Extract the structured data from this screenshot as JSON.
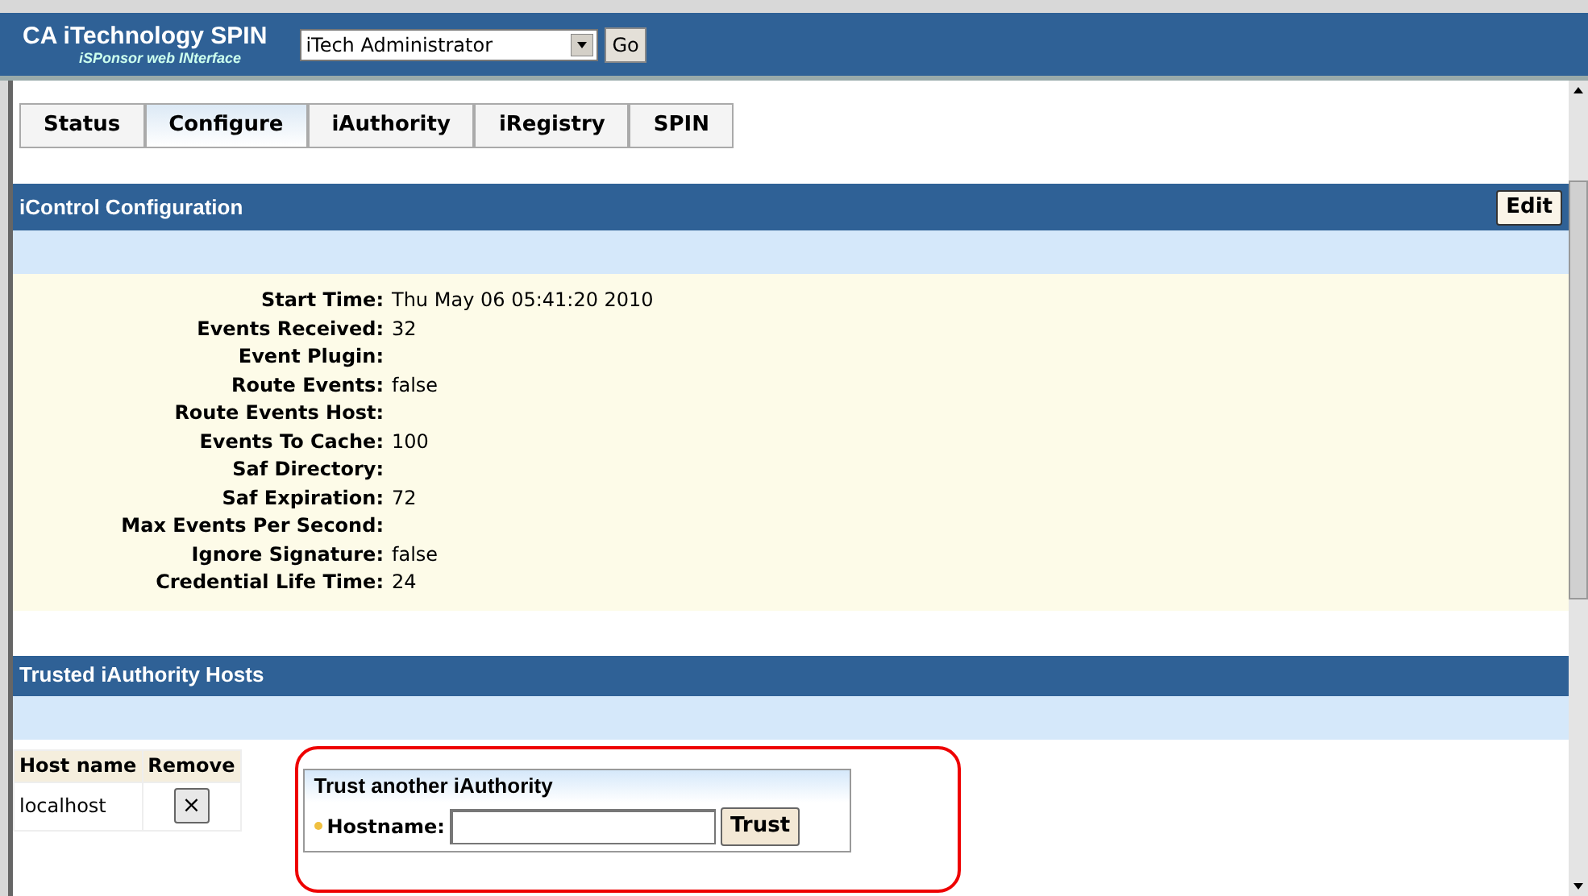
{
  "header": {
    "title": "CA iTechnology SPIN",
    "subtitle": "iSPonsor web INterface",
    "role_select": {
      "value": "iTech Administrator"
    },
    "go_button": "Go"
  },
  "tabs": [
    {
      "label": "Status",
      "selected": false
    },
    {
      "label": "Configure",
      "selected": true
    },
    {
      "label": "iAuthority",
      "selected": false
    },
    {
      "label": "iRegistry",
      "selected": false
    },
    {
      "label": "SPIN",
      "selected": false
    }
  ],
  "config_section": {
    "title": "iControl Configuration",
    "edit_button": "Edit",
    "fields": [
      {
        "label": "Start Time:",
        "value": "Thu May 06 05:41:20 2010"
      },
      {
        "label": "Events Received:",
        "value": "32"
      },
      {
        "label": "Event Plugin:"
      },
      {
        "label": "Route Events:",
        "value": "false"
      },
      {
        "label": "Route Events Host:"
      },
      {
        "label": "Events To Cache:",
        "value": "100"
      },
      {
        "label": "Saf Directory:"
      },
      {
        "label": "Saf Expiration:",
        "value": "72"
      },
      {
        "label": "Max Events Per Second:"
      },
      {
        "label": "Ignore Signature:",
        "value": "false"
      },
      {
        "label": "Credential Life Time:",
        "value": "24"
      }
    ]
  },
  "hosts_section": {
    "title": "Trusted iAuthority Hosts",
    "table": {
      "columns": [
        "Host name",
        "Remove"
      ],
      "rows": [
        {
          "host": "localhost",
          "remove": "×"
        }
      ]
    },
    "trust_form": {
      "title": "Trust another iAuthority",
      "label": "Hostname:",
      "button": "Trust"
    }
  }
}
